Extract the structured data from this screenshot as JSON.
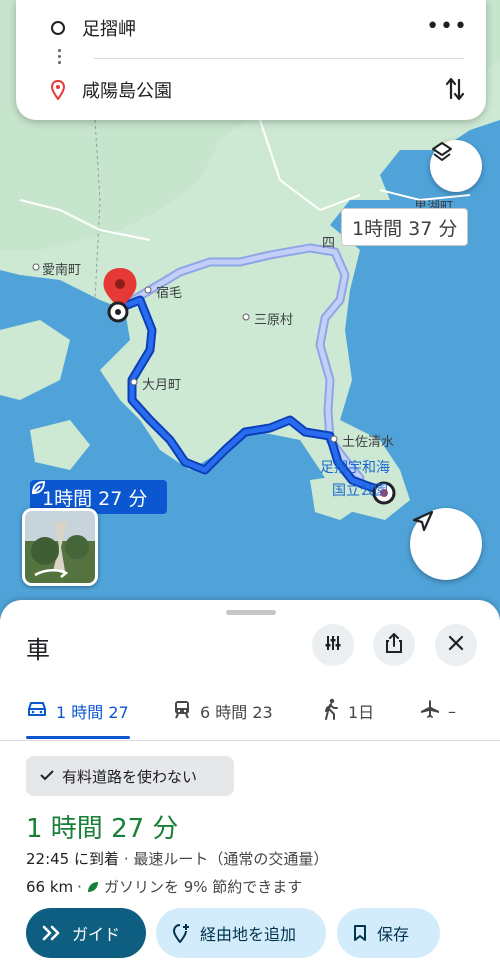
{
  "search": {
    "origin": "足摺岬",
    "destination": "咸陽島公園"
  },
  "map": {
    "callout_alt": "1時間 37 分",
    "callout_main": "1時間 27 分",
    "labels": {
      "ainan": "愛南町",
      "sukumo": "宿毛",
      "mihara": "三原村",
      "otsuki": "大月町",
      "tosashimizu": "土佐清水",
      "park_line1": "足摺宇和海",
      "park_line2": "国立公園",
      "satokoji": "里湖町",
      "shimanto": "四"
    }
  },
  "sheet": {
    "mode_title": "車",
    "tabs": [
      {
        "label": "1 時間 27",
        "icon": "car-icon"
      },
      {
        "label": "6 時間 23",
        "icon": "train-icon"
      },
      {
        "label": "1日",
        "icon": "walk-icon"
      },
      {
        "label": "–",
        "icon": "plane-icon"
      }
    ],
    "chip": "有料道路を使わない",
    "duration": "1 時間 27 分",
    "arrival_time": "22:45",
    "arrival_suffix": "に到着",
    "route_desc": "· 最速ルート（通常の交通量）",
    "distance": "66 km",
    "fuel_text": "ガソリンを 9% 節約できます",
    "buttons": {
      "guide": "ガイド",
      "add_stop": "経由地を追加",
      "save": "保存"
    }
  },
  "colors": {
    "route_main": "#1a5fe0",
    "route_alt": "#a6b8f0",
    "land": "#cde9d3",
    "sea": "#4fa3d9",
    "accent_green": "#188038"
  }
}
